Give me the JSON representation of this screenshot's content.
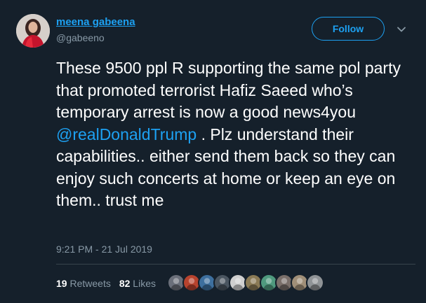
{
  "author": {
    "display_name": "meena gabeena",
    "handle": "@gabeeno",
    "avatar_icon": "profile-photo-avatar"
  },
  "actions": {
    "follow_label": "Follow",
    "menu_icon": "chevron-down-icon"
  },
  "tweet": {
    "text_part1": "These 9500 ppl R supporting the same pol party that promoted terrorist Hafiz Saeed who’s temporary arrest is now a good news4you ",
    "mention": "@realDonaldTrump",
    "text_part2": " . Plz understand their capabilities.. either send them back so they can enjoy such concerts at home or keep an eye on them.. trust me",
    "timestamp": "9:21 PM - 21 Jul 2019"
  },
  "stats": {
    "retweets_count": "19",
    "retweets_label": "Retweets",
    "likes_count": "82",
    "likes_label": "Likes"
  },
  "likers": [
    {
      "color": "#6a6f7a"
    },
    {
      "color": "#b8432e"
    },
    {
      "color": "#3d6f9e"
    },
    {
      "color": "#4a5560"
    },
    {
      "color": "#cfcfcf"
    },
    {
      "color": "#8a7a55"
    },
    {
      "color": "#4f9a7e"
    },
    {
      "color": "#7a6f6a"
    },
    {
      "color": "#a08f78"
    },
    {
      "color": "#8f9396"
    }
  ],
  "colors": {
    "background": "#15202b",
    "accent": "#1da1f2",
    "secondary_text": "#8899a6",
    "primary_text": "#ffffff",
    "divider": "#38444d"
  }
}
